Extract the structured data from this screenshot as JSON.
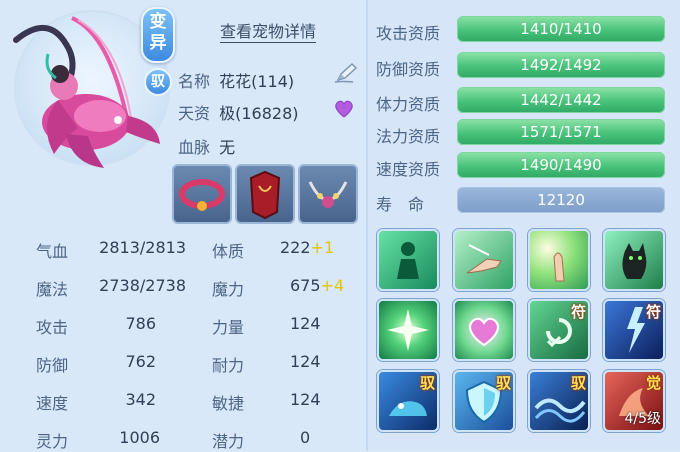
{
  "header": {
    "badge_mutation": "变异",
    "badge_drive": "驭",
    "detail_link": "查看宠物详情"
  },
  "info": {
    "name_label": "名称",
    "name_value": "花花(114)",
    "aptitude_label": "天资",
    "aptitude_value": "极(16828)",
    "bloodline_label": "血脉",
    "bloodline_value": "无"
  },
  "equipment": [
    {
      "icon": "collar-equipment-icon"
    },
    {
      "icon": "armor-equipment-icon"
    },
    {
      "icon": "necklace-equipment-icon"
    }
  ],
  "stats": [
    {
      "label": "气血",
      "value": "2813/2813"
    },
    {
      "label": "魔法",
      "value": "2738/2738"
    },
    {
      "label": "攻击",
      "value": "786"
    },
    {
      "label": "防御",
      "value": "762"
    },
    {
      "label": "速度",
      "value": "342"
    },
    {
      "label": "灵力",
      "value": "1006"
    }
  ],
  "attributes": [
    {
      "label": "体质",
      "value": "222",
      "bonus": "+1"
    },
    {
      "label": "魔力",
      "value": "675",
      "bonus": "+4"
    },
    {
      "label": "力量",
      "value": "124",
      "bonus": ""
    },
    {
      "label": "耐力",
      "value": "124",
      "bonus": ""
    },
    {
      "label": "敏捷",
      "value": "124",
      "bonus": ""
    },
    {
      "label": "潜力",
      "value": "0",
      "bonus": ""
    }
  ],
  "qualities": [
    {
      "label": "攻击资质",
      "value": "1410/1410",
      "fill": 1.0
    },
    {
      "label": "防御资质",
      "value": "1492/1492",
      "fill": 1.0
    },
    {
      "label": "体力资质",
      "value": "1442/1442",
      "fill": 1.0
    },
    {
      "label": "法力资质",
      "value": "1571/1571",
      "fill": 1.0
    },
    {
      "label": "速度资质",
      "value": "1490/1490",
      "fill": 1.0
    }
  ],
  "life": {
    "label": "寿　命",
    "value": "12120"
  },
  "skills": [
    {
      "icon": "green-figure-skill-icon",
      "tag": ""
    },
    {
      "icon": "hand-strike-skill-icon",
      "tag": ""
    },
    {
      "icon": "palm-light-skill-icon",
      "tag": ""
    },
    {
      "icon": "black-cat-skill-icon",
      "tag": ""
    },
    {
      "icon": "green-star-skill-icon",
      "tag": ""
    },
    {
      "icon": "heart-skill-icon",
      "tag": ""
    },
    {
      "icon": "swirl-charm-skill-icon",
      "tag": "符"
    },
    {
      "icon": "lightning-charm-skill-icon",
      "tag": "符"
    },
    {
      "icon": "beast-drive-skill-icon",
      "tag": "驭"
    },
    {
      "icon": "shield-drive-skill-icon",
      "tag": "驭"
    },
    {
      "icon": "wave-drive-skill-icon",
      "tag": "驭"
    },
    {
      "icon": "awaken-skill-icon",
      "tag": "觉",
      "level": "4/5级"
    }
  ],
  "colors": {
    "quality_bar": "#49c27a",
    "life_bar": "#7c9dc8",
    "bonus": "#e5c300",
    "panel": "#d9e8f9"
  }
}
